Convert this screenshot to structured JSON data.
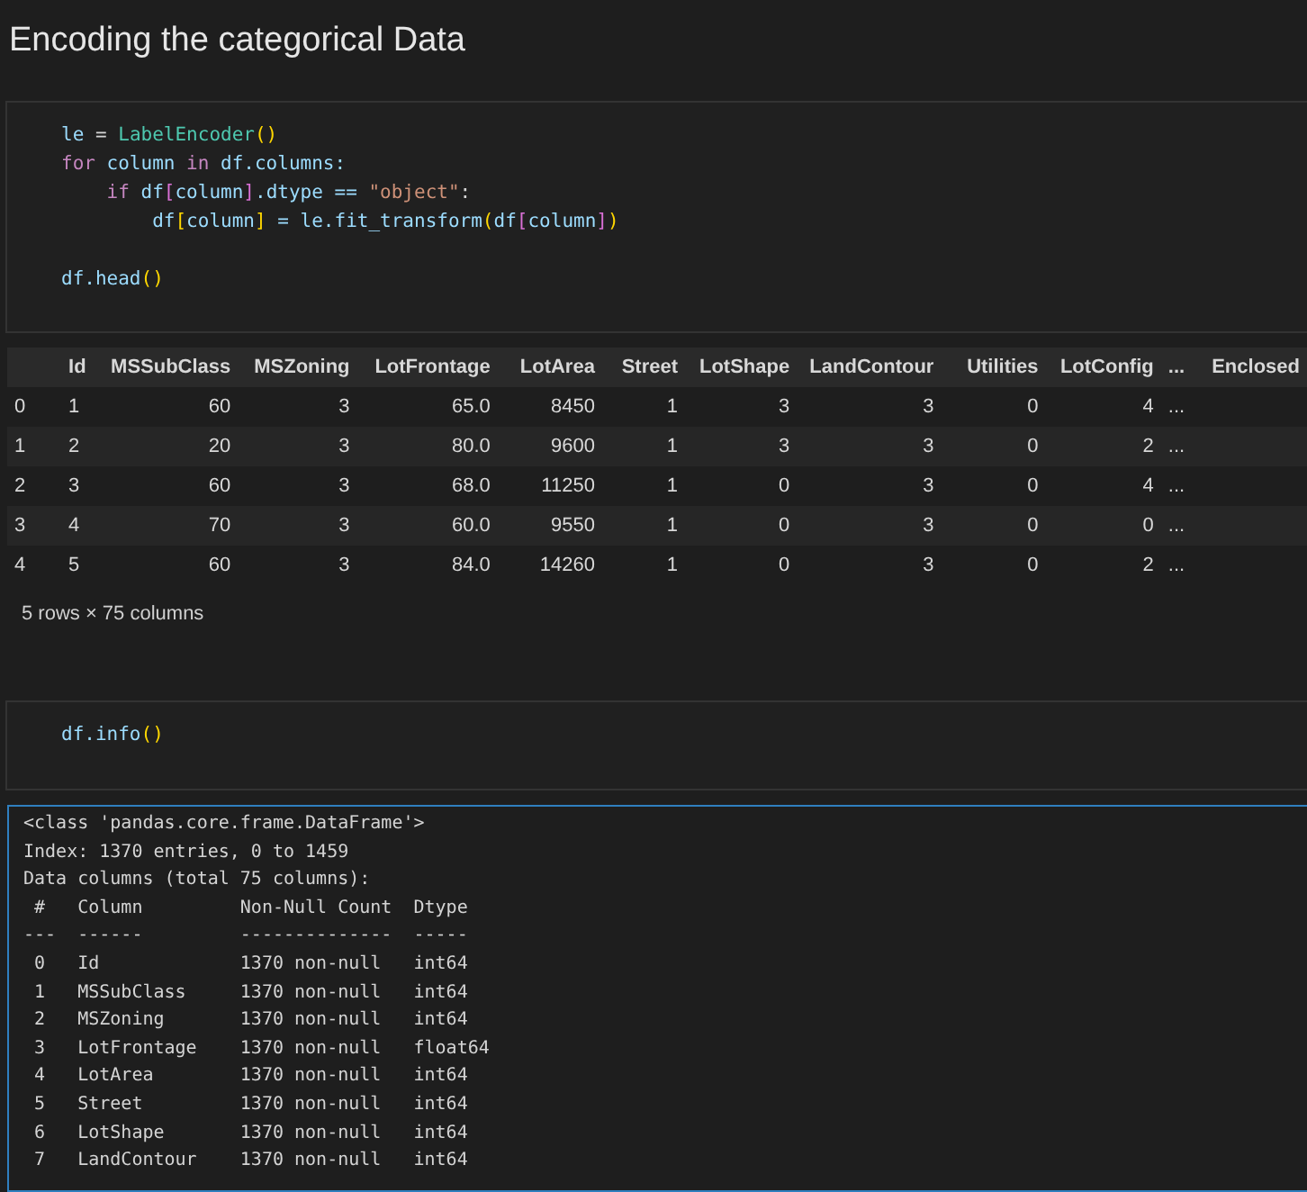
{
  "heading": "Encoding the categorical Data",
  "code_cell_1": {
    "lines": [
      [
        {
          "text": "le",
          "kind": "var"
        },
        {
          "text": " = ",
          "kind": "plain"
        },
        {
          "text": "LabelEncoder",
          "kind": "class"
        },
        {
          "text": "()",
          "kind": "bracket"
        }
      ],
      [
        {
          "text": "for",
          "kind": "keyword"
        },
        {
          "text": " column ",
          "kind": "var"
        },
        {
          "text": "in",
          "kind": "keyword"
        },
        {
          "text": " df.columns:",
          "kind": "var"
        }
      ],
      [
        {
          "text": "    if",
          "kind": "keyword"
        },
        {
          "text": " df",
          "kind": "var"
        },
        {
          "text": "[",
          "kind": "bracket2"
        },
        {
          "text": "column",
          "kind": "var"
        },
        {
          "text": "]",
          "kind": "bracket2"
        },
        {
          "text": ".dtype == ",
          "kind": "var"
        },
        {
          "text": "\"object\"",
          "kind": "string"
        },
        {
          "text": ":",
          "kind": "plain"
        }
      ],
      [
        {
          "text": "        df",
          "kind": "var"
        },
        {
          "text": "[",
          "kind": "bracket"
        },
        {
          "text": "column",
          "kind": "var"
        },
        {
          "text": "]",
          "kind": "bracket"
        },
        {
          "text": " = le.fit_transform",
          "kind": "var"
        },
        {
          "text": "(",
          "kind": "bracket"
        },
        {
          "text": "df",
          "kind": "var"
        },
        {
          "text": "[",
          "kind": "bracket2"
        },
        {
          "text": "column",
          "kind": "var"
        },
        {
          "text": "]",
          "kind": "bracket2"
        },
        {
          "text": ")",
          "kind": "bracket"
        }
      ],
      [
        {
          "kind": "blank"
        }
      ],
      [
        {
          "text": "df.head",
          "kind": "var"
        },
        {
          "text": "()",
          "kind": "bracket"
        }
      ]
    ]
  },
  "dataframe": {
    "columns": [
      "",
      "Id",
      "MSSubClass",
      "MSZoning",
      "LotFrontage",
      "LotArea",
      "Street",
      "LotShape",
      "LandContour",
      "Utilities",
      "LotConfig",
      "...",
      "Enclosed"
    ],
    "rows": [
      [
        "0",
        "1",
        "60",
        "3",
        "65.0",
        "8450",
        "1",
        "3",
        "3",
        "0",
        "4",
        "..."
      ],
      [
        "1",
        "2",
        "20",
        "3",
        "80.0",
        "9600",
        "1",
        "3",
        "3",
        "0",
        "2",
        "..."
      ],
      [
        "2",
        "3",
        "60",
        "3",
        "68.0",
        "11250",
        "1",
        "0",
        "3",
        "0",
        "4",
        "..."
      ],
      [
        "3",
        "4",
        "70",
        "3",
        "60.0",
        "9550",
        "1",
        "0",
        "3",
        "0",
        "0",
        "..."
      ],
      [
        "4",
        "5",
        "60",
        "3",
        "84.0",
        "14260",
        "1",
        "0",
        "3",
        "0",
        "2",
        "..."
      ]
    ],
    "shape": "5 rows × 75 columns"
  },
  "code_cell_2": {
    "lines": [
      [
        {
          "text": "df.info",
          "kind": "var"
        },
        {
          "text": "()",
          "kind": "bracket"
        }
      ]
    ]
  },
  "output": {
    "selected": true,
    "lines": [
      "<class 'pandas.core.frame.DataFrame'>",
      "Index: 1370 entries, 0 to 1459",
      "Data columns (total 75 columns):",
      " #   Column         Non-Null Count  Dtype  ",
      "---  ------         --------------  -----  ",
      " 0   Id             1370 non-null   int64  ",
      " 1   MSSubClass     1370 non-null   int64  ",
      " 2   MSZoning       1370 non-null   int64  ",
      " 3   LotFrontage    1370 non-null   float64",
      " 4   LotArea        1370 non-null   int64  ",
      " 5   Street         1370 non-null   int64  ",
      " 6   LotShape       1370 non-null   int64  ",
      " 7   LandContour    1370 non-null   int64  "
    ]
  }
}
